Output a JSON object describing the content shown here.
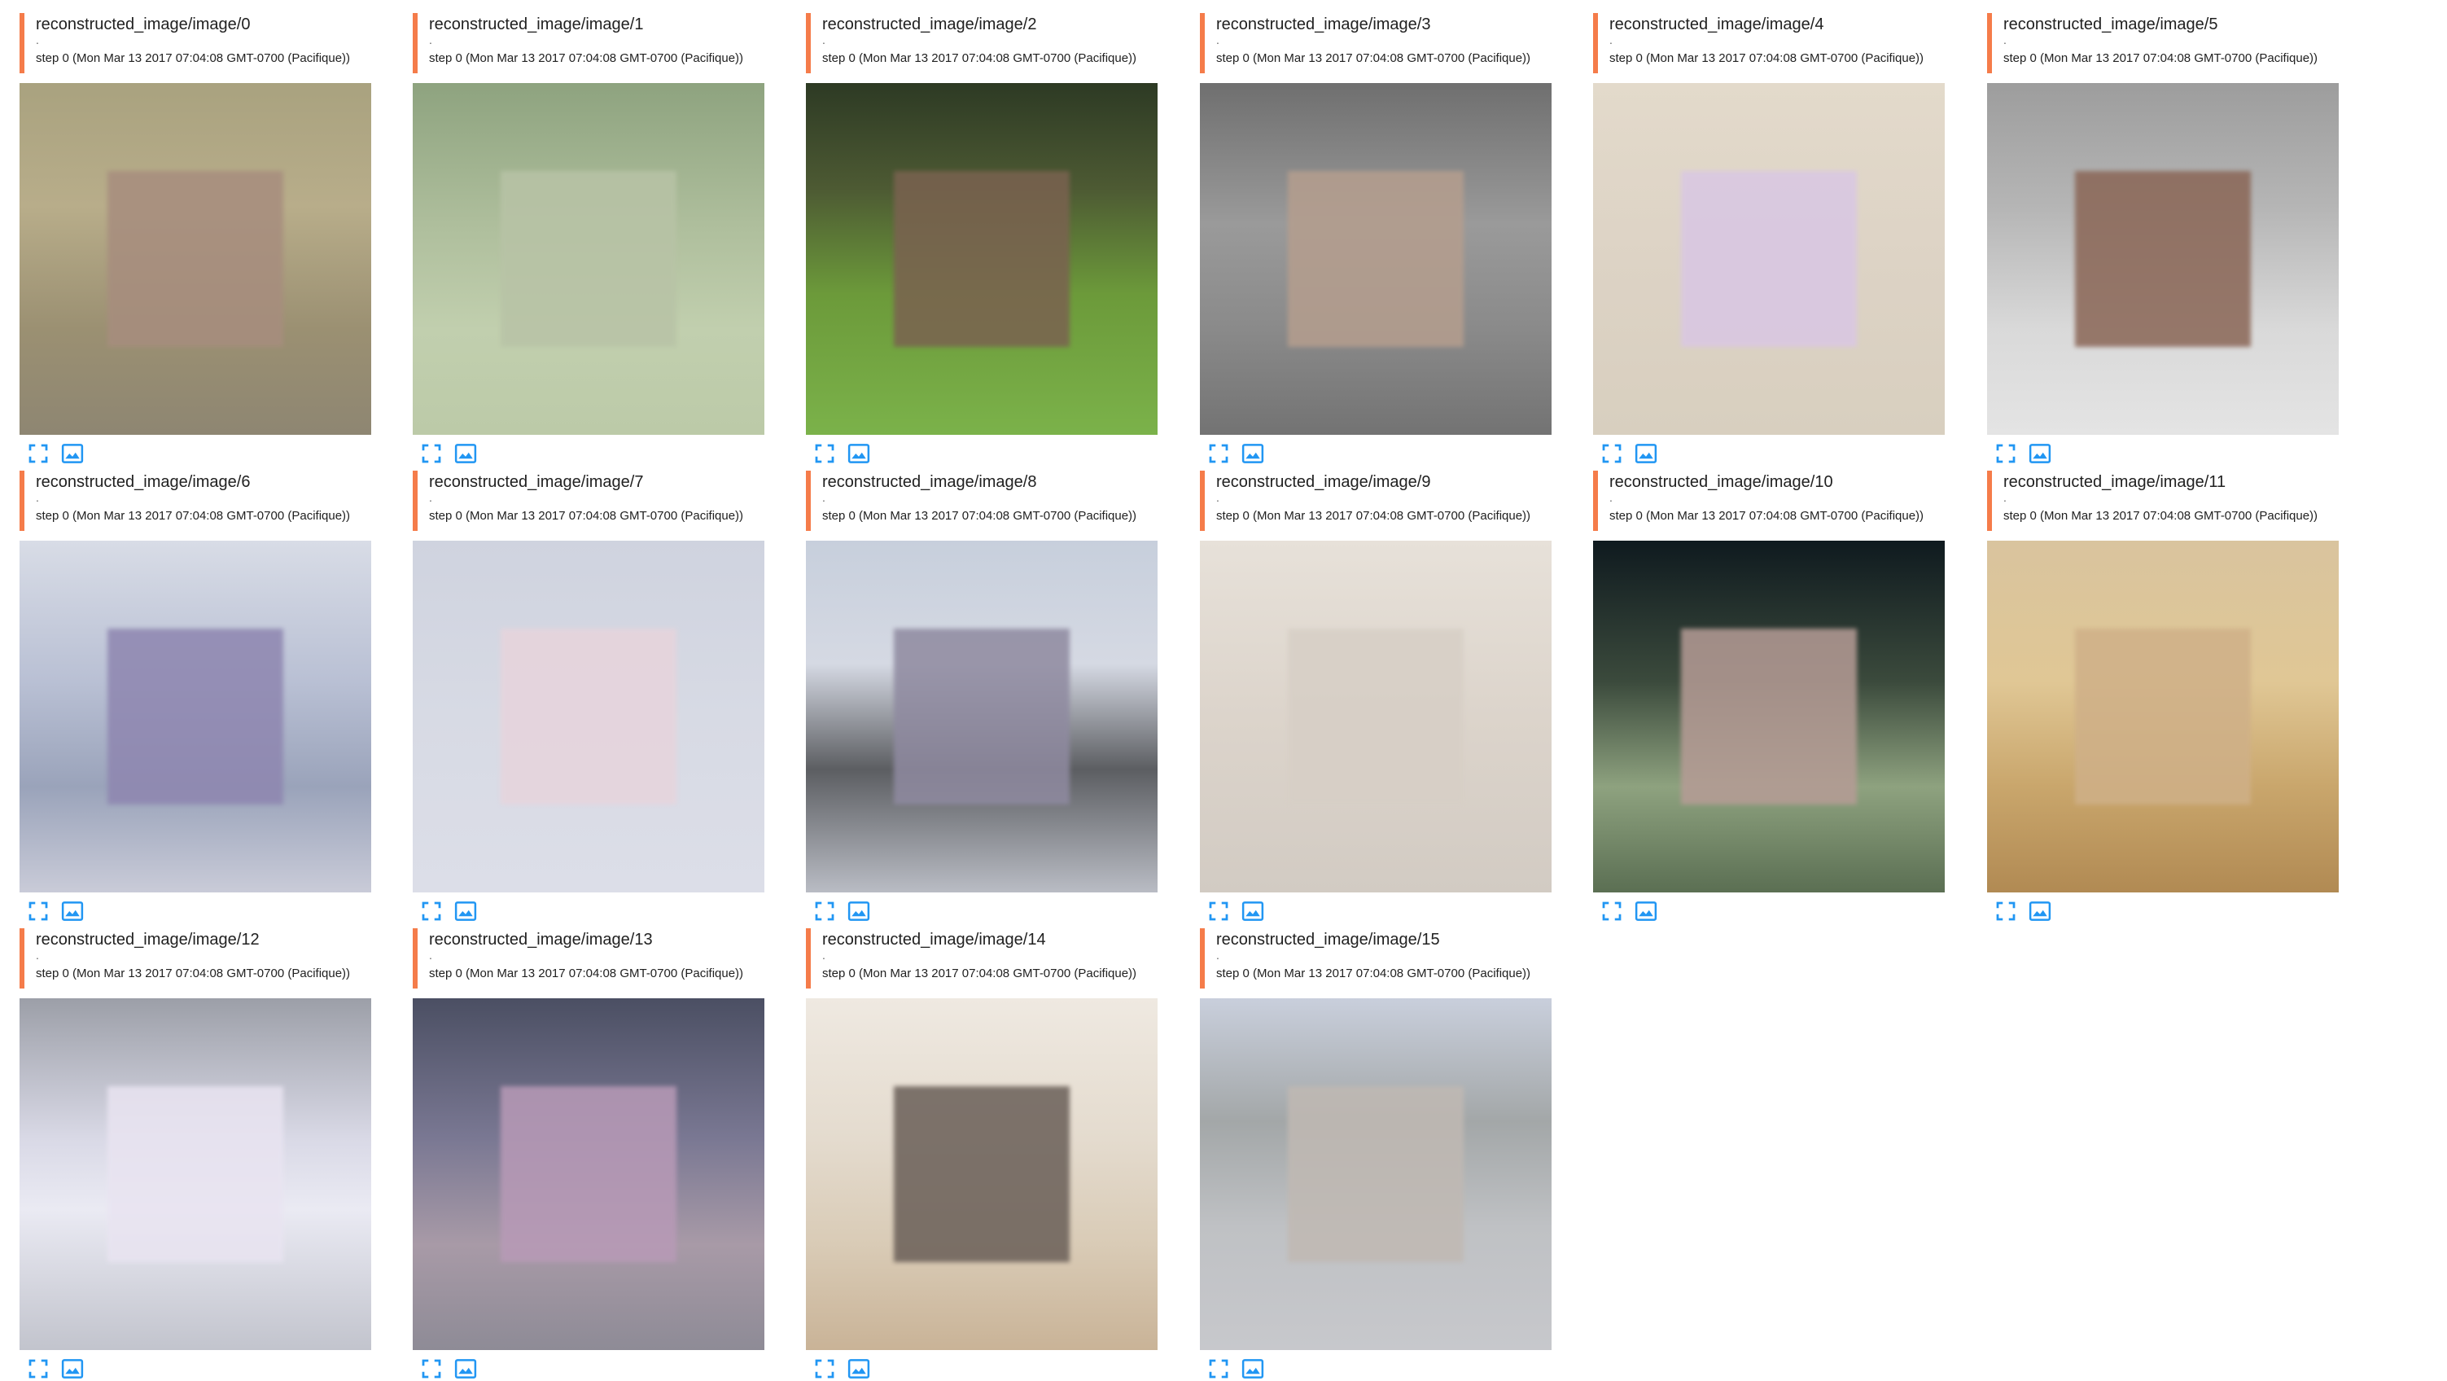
{
  "cards": [
    {
      "tag": "reconstructed_image/image/0",
      "dot": ".",
      "step": "step 0 (Mon Mar 13 2017 07:04:08 GMT-0700 (Pacifique))",
      "bg": "linear-gradient(180deg,#a9a27f 0%,#b8ad8a 35%,#9b9072 70%,#8e8672 100%)",
      "patch": "#a78d7e"
    },
    {
      "tag": "reconstructed_image/image/1",
      "dot": ".",
      "step": "step 0 (Mon Mar 13 2017 07:04:08 GMT-0700 (Pacifique))",
      "bg": "linear-gradient(180deg,#8ea37f 0%,#aebe9c 40%,#c1cfae 70%,#bccaa8 100%)",
      "patch": "#b8c3a6"
    },
    {
      "tag": "reconstructed_image/image/2",
      "dot": ".",
      "step": "step 0 (Mon Mar 13 2017 07:04:08 GMT-0700 (Pacifique))",
      "bg": "linear-gradient(180deg,#2d3a24 0%,#4d5a33 30%,#6c9a3a 60%,#7bb24a 100%)",
      "patch": "#7a6250"
    },
    {
      "tag": "reconstructed_image/image/3",
      "dot": ".",
      "step": "step 0 (Mon Mar 13 2017 07:04:08 GMT-0700 (Pacifique))",
      "bg": "linear-gradient(180deg,#6f6f6f 0%,#9a9a9a 40%,#8a8a8a 70%,#737373 100%)",
      "patch": "#b59e8e"
    },
    {
      "tag": "reconstructed_image/image/4",
      "dot": ".",
      "step": "step 0 (Mon Mar 13 2017 07:04:08 GMT-0700 (Pacifique))",
      "bg": "linear-gradient(180deg,#e3dacb 0%,#ddd3c5 50%,#d8cfbf 100%)",
      "patch": "#d9c7e4"
    },
    {
      "tag": "reconstructed_image/image/5",
      "dot": ".",
      "step": "step 0 (Mon Mar 13 2017 07:04:08 GMT-0700 (Pacifique))",
      "bg": "linear-gradient(180deg,#9d9d9d 0%,#b5b5b5 35%,#d9d9d9 70%,#e4e4e4 100%)",
      "patch": "#8a6656"
    },
    {
      "tag": "reconstructed_image/image/6",
      "dot": ".",
      "step": "step 0 (Mon Mar 13 2017 07:04:08 GMT-0700 (Pacifique))",
      "bg": "linear-gradient(180deg,#d8dce6 0%,#b9c0d4 40%,#9aa3ba 70%,#c9cbd8 100%)",
      "patch": "#8e86b0"
    },
    {
      "tag": "reconstructed_image/image/7",
      "dot": ".",
      "step": "step 0 (Mon Mar 13 2017 07:04:08 GMT-0700 (Pacifique))",
      "bg": "linear-gradient(180deg,#cfd3df 0%,#d7dae4 50%,#dcdee8 100%)",
      "patch": "#e7d4dc"
    },
    {
      "tag": "reconstructed_image/image/8",
      "dot": ".",
      "step": "step 0 (Mon Mar 13 2017 07:04:08 GMT-0700 (Pacifique))",
      "bg": "linear-gradient(180deg,#c7cfdc 0%,#d5d9e3 35%,#5c5e62 65%,#b9bcc4 100%)",
      "patch": "#8f8aa0"
    },
    {
      "tag": "reconstructed_image/image/9",
      "dot": ".",
      "step": "step 0 (Mon Mar 13 2017 07:04:08 GMT-0700 (Pacifique))",
      "bg": "linear-gradient(180deg,#e7e1d9 0%,#dcd4cb 50%,#d2cbc3 100%)",
      "patch": "#d7cfc6"
    },
    {
      "tag": "reconstructed_image/image/10",
      "dot": ".",
      "step": "step 0 (Mon Mar 13 2017 07:04:08 GMT-0700 (Pacifique))",
      "bg": "linear-gradient(180deg,#0f1a1f 0%,#3b4a3c 40%,#8ea27f 70%,#5b6f53 100%)",
      "patch": "#b69c96"
    },
    {
      "tag": "reconstructed_image/image/11",
      "dot": ".",
      "step": "step 0 (Mon Mar 13 2017 07:04:08 GMT-0700 (Pacifique))",
      "bg": "linear-gradient(180deg,#d9c49e 0%,#e0c795 40%,#c9a66c 70%,#b18a53 100%)",
      "patch": "#cfb088"
    },
    {
      "tag": "reconstructed_image/image/12",
      "dot": ".",
      "step": "step 0 (Mon Mar 13 2017 07:04:08 GMT-0700 (Pacifique))",
      "bg": "linear-gradient(180deg,#9c9fa8 0%,#d9d9e6 40%,#eaeaf3 60%,#c2c4cd 100%)",
      "patch": "#e9e4f1"
    },
    {
      "tag": "reconstructed_image/image/13",
      "dot": ".",
      "step": "step 0 (Mon Mar 13 2017 07:04:08 GMT-0700 (Pacifique))",
      "bg": "linear-gradient(180deg,#4b4f63 0%,#7a7893 40%,#a89aa7 70%,#8e8b96 100%)",
      "patch": "#b89ab7"
    },
    {
      "tag": "reconstructed_image/image/14",
      "dot": ".",
      "step": "step 0 (Mon Mar 13 2017 07:04:08 GMT-0700 (Pacifique))",
      "bg": "linear-gradient(180deg,#efe9e1 0%,#e4dbce 40%,#d9cbb6 70%,#c9b397 100%)",
      "patch": "#6a5f58"
    },
    {
      "tag": "reconstructed_image/image/15",
      "dot": ".",
      "step": "step 0 (Mon Mar 13 2017 07:04:08 GMT-0700 (Pacifique))",
      "bg": "linear-gradient(180deg,#c9cfdc 0%,#a3a7a8 35%,#bfc1c4 65%,#c7c8cc 100%)",
      "patch": "#c0b9b3"
    }
  ],
  "icons": {
    "expand": "expand-icon",
    "fit": "fit-image-icon",
    "color": "#2196f3"
  }
}
